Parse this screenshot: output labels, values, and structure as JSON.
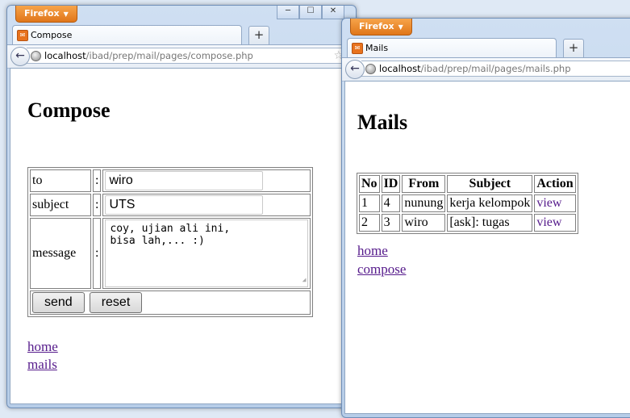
{
  "browser": {
    "menu_label": "Firefox",
    "new_tab_label": "+"
  },
  "compose_window": {
    "tab_title": "Compose",
    "url_host": "localhost",
    "url_path": "/ibad/prep/mail/pages/compose.php",
    "heading": "Compose",
    "form": {
      "to_label": "to",
      "subject_label": "subject",
      "message_label": "message",
      "separator": ":",
      "to_value": "wiro",
      "subject_value": "UTS",
      "message_value": "coy, ujian ali ini,\nbisa lah,... :)",
      "send_label": "send",
      "reset_label": "reset"
    },
    "links": {
      "home": "home",
      "mails": "mails"
    }
  },
  "mails_window": {
    "tab_title": "Mails",
    "url_host": "localhost",
    "url_path": "/ibad/prep/mail/pages/mails.php",
    "heading": "Mails",
    "table": {
      "columns": [
        "No",
        "ID",
        "From",
        "Subject",
        "Action"
      ],
      "rows": [
        {
          "no": "1",
          "id": "4",
          "from": "nunung",
          "subject": "kerja kelompok",
          "action": "view"
        },
        {
          "no": "2",
          "id": "3",
          "from": "wiro",
          "subject": "[ask]: tugas",
          "action": "view"
        }
      ]
    },
    "links": {
      "home": "home",
      "compose": "compose"
    }
  }
}
